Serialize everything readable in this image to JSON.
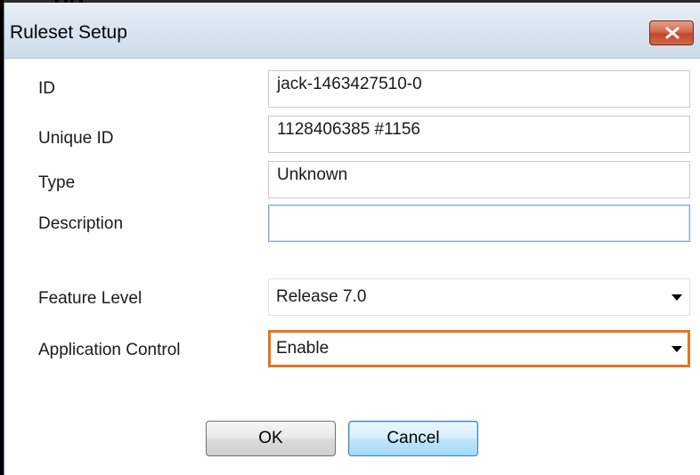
{
  "window": {
    "title": "Ruleset Setup",
    "clipped_heading": "pp"
  },
  "fields": {
    "id": {
      "label": "ID",
      "value": "jack-1463427510-0"
    },
    "unique_id": {
      "label": "Unique ID",
      "value": "1128406385 #1156"
    },
    "type": {
      "label": "Type",
      "value": "Unknown"
    },
    "description": {
      "label": "Description",
      "value": ""
    },
    "feature_level": {
      "label": "Feature Level",
      "selected": "Release 7.0"
    },
    "application_control": {
      "label": "Application Control",
      "selected": "Enable"
    }
  },
  "buttons": {
    "ok": "OK",
    "cancel": "Cancel"
  },
  "colors": {
    "focus_orange": "#e8731f",
    "close_red": "#c4462b",
    "titlebar_blue": "#dbe5f0"
  },
  "icons": {
    "close": "close-x-icon",
    "dropdown": "chevron-down-icon"
  }
}
